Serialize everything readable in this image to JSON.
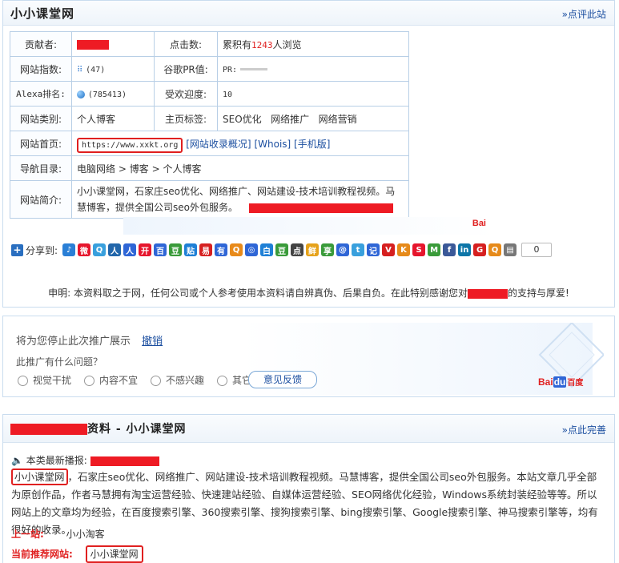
{
  "site": {
    "title": "小小课堂网",
    "comment_link": "»点评此站",
    "labels": {
      "contributor": "贡献者:",
      "clicks": "点击数:",
      "site_index": "网站指数:",
      "google_pr": "谷歌PR值:",
      "alexa": "Alexa排名:",
      "popularity": "受欢迎度:",
      "category": "网站类别:",
      "tags": "主页标签:",
      "homepage": "网站首页:",
      "nav": "导航目录:",
      "intro": "网站简介:"
    },
    "clicks_prefix": "累积有",
    "clicks_value": "1243",
    "clicks_suffix": "人浏览",
    "site_index_value": "(47)",
    "google_pr_value": "PR:",
    "alexa_value": "(785413)",
    "popularity_value": "10",
    "category_value": "个人博客",
    "tags": [
      "SEO优化",
      "网络推广",
      "网络营销"
    ],
    "homepage_url": "https://www.xxkt.org",
    "homepage_links": [
      "[网站收录概况]",
      "[Whois]",
      "[手机版]"
    ],
    "nav_path": [
      "电脑网络",
      ">",
      "博客",
      ">",
      "个人博客"
    ],
    "intro_text": "小小课堂网，石家庄seo优化、网络推广、网站建设-技术培训教程视频。马慧博客，提供全国公司seo外包服务。"
  },
  "share": {
    "label": "分享到:",
    "count": "0",
    "icons": [
      {
        "name": "qzone-icon",
        "color": "#2a7fd6",
        "glyph": "♪"
      },
      {
        "name": "weibo-icon",
        "color": "#e6162d",
        "glyph": "微"
      },
      {
        "name": "qq-weibo-icon",
        "color": "#39a0dd",
        "glyph": "Q"
      },
      {
        "name": "renren-icon",
        "color": "#2266aa",
        "glyph": "人"
      },
      {
        "name": "tieba-icon",
        "color": "#2f66d6",
        "glyph": "人"
      },
      {
        "name": "kaixin-icon",
        "color": "#e6162d",
        "glyph": "开"
      },
      {
        "name": "baidu-icon",
        "color": "#2f66d6",
        "glyph": "百"
      },
      {
        "name": "douban-icon",
        "color": "#3a9b3a",
        "glyph": "豆"
      },
      {
        "name": "tsohu-icon",
        "color": "#1f80d6",
        "glyph": "贴"
      },
      {
        "name": "netease-icon",
        "color": "#d62020",
        "glyph": "易"
      },
      {
        "name": "youdao-icon",
        "color": "#2f66d6",
        "glyph": "有"
      },
      {
        "name": "qq-friend-icon",
        "color": "#e88a1a",
        "glyph": "Q"
      },
      {
        "name": "baidu-zone-icon",
        "color": "#2f66d6",
        "glyph": "◎"
      },
      {
        "name": "bai-icon",
        "color": "#1f80d6",
        "glyph": "白"
      },
      {
        "name": "dou-icon",
        "color": "#3a9b3a",
        "glyph": "豆"
      },
      {
        "name": "diandian-icon",
        "color": "#444",
        "glyph": "点"
      },
      {
        "name": "xianguo-icon",
        "color": "#e6a21a",
        "glyph": "鲜"
      },
      {
        "name": "share-icon",
        "color": "#3a9b3a",
        "glyph": "享"
      },
      {
        "name": "mail-icon",
        "color": "#2f66d6",
        "glyph": "@"
      },
      {
        "name": "twitter-icon",
        "color": "#39a0dd",
        "glyph": "t"
      },
      {
        "name": "note-icon",
        "color": "#2f66d6",
        "glyph": "记"
      },
      {
        "name": "tc-icon",
        "color": "#d62020",
        "glyph": "V"
      },
      {
        "name": "kx-icon",
        "color": "#e68a1a",
        "glyph": "K"
      },
      {
        "name": "sohu-icon",
        "color": "#e6162d",
        "glyph": "S"
      },
      {
        "name": "mop-icon",
        "color": "#3a9b3a",
        "glyph": "M"
      },
      {
        "name": "facebook-icon",
        "color": "#3b5998",
        "glyph": "f"
      },
      {
        "name": "linkedin-icon",
        "color": "#0e76a8",
        "glyph": "in"
      },
      {
        "name": "gmail-icon",
        "color": "#d62020",
        "glyph": "G"
      },
      {
        "name": "qq-icon",
        "color": "#e68a1a",
        "glyph": "Q"
      },
      {
        "name": "print-icon",
        "color": "#777",
        "glyph": "▤"
      }
    ]
  },
  "disclaimer": {
    "text1": "申明: 本资料取之于网，任何公司或个人参考使用本资料请自辨真伪、后果自负。在此特别感谢您对",
    "text2": "的支持与厚爱!"
  },
  "feedback": {
    "title": "将为您停止此次推广展示",
    "undo": "撤销",
    "question": "此推广有什么问题？",
    "options": [
      "视觉干扰",
      "内容不宜",
      "不感兴趣",
      "其它"
    ],
    "button": "意见反馈",
    "brand": "Bai",
    "brand_du": "du",
    "brand_suffix": "百度"
  },
  "article": {
    "title_suffix": "资料 - 小小课堂网",
    "more_link": "»点此完善",
    "latest_label": "本类最新播报:",
    "highlight_name": "小小课堂网",
    "body": "，石家庄seo优化、网络推广、网站建设-技术培训教程视频。马慧博客，提供全国公司seo外包服务。本站文章几乎全部为原创作品，作者马慧拥有淘宝运营经验、快速建站经验、自媒体运营经验、SEO网络优化经验，Windows系统封装经验等等。所以网站上的文章均为经验，在百度搜索引擎、360搜索引擎、搜狗搜索引擎、bing搜索引擎、Google搜索引擎、神马搜索引擎等，均有很好的收录。",
    "prev_label": "上一站:",
    "prev_value": "小小淘客",
    "recommend_label": "当前推荐网站:",
    "recommend_value": "小小课堂网"
  }
}
